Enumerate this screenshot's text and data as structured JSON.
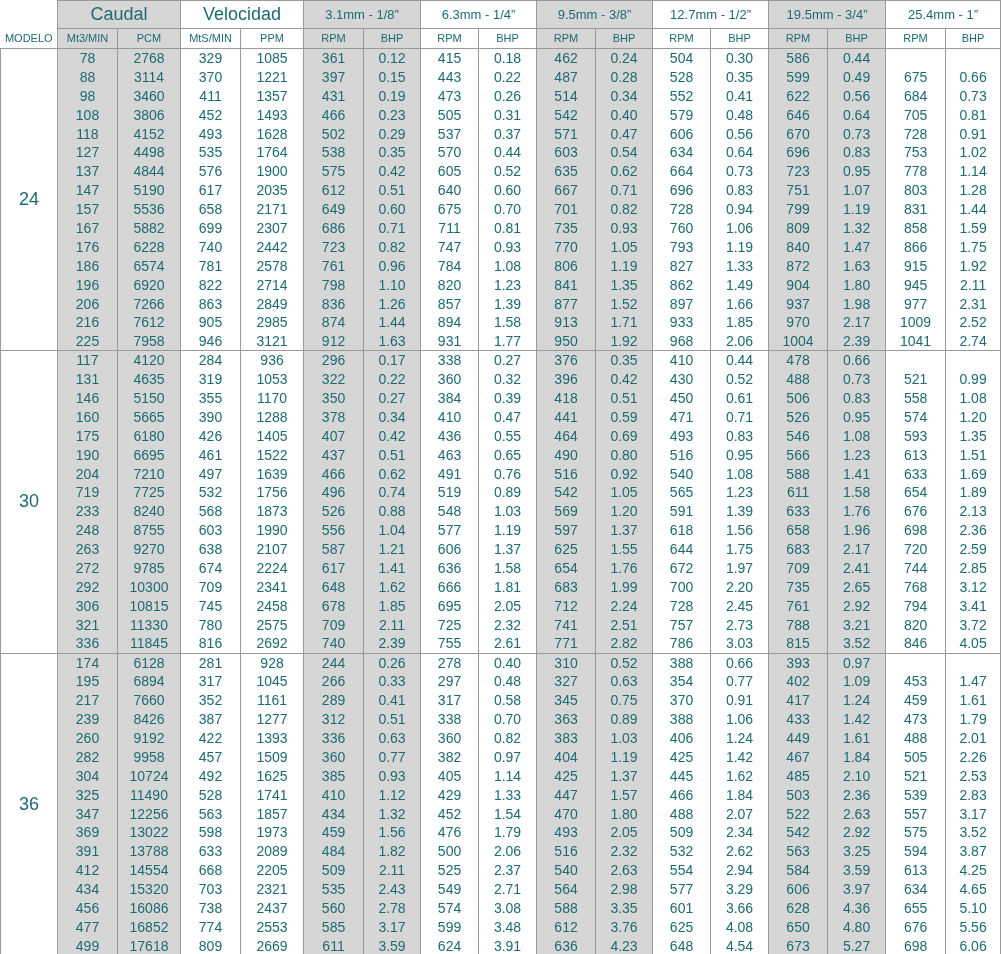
{
  "table": {
    "model_label": "MODELO",
    "groups": [
      {
        "label": "Caudal",
        "columns": [
          "Mt3/MIN",
          "PCM"
        ]
      },
      {
        "label": "Velocidad",
        "columns": [
          "MtS/MIN",
          "PPM"
        ]
      },
      {
        "label": "3.1mm - 1/8”",
        "columns": [
          "RPM",
          "BHP"
        ]
      },
      {
        "label": "6.3mm - 1/4”",
        "columns": [
          "RPM",
          "BHP"
        ]
      },
      {
        "label": "9.5mm - 3/8”",
        "columns": [
          "RPM",
          "BHP"
        ]
      },
      {
        "label": "12.7mm - 1/2”",
        "columns": [
          "RPM",
          "BHP"
        ]
      },
      {
        "label": "19.5mm - 3/4”",
        "columns": [
          "RPM",
          "BHP"
        ]
      },
      {
        "label": "25.4mm - 1”",
        "columns": [
          "RPM",
          "BHP"
        ]
      }
    ],
    "models": [
      {
        "model": "24",
        "rows": [
          [
            "78",
            "2768",
            "329",
            "1085",
            "361",
            "0.12",
            "415",
            "0.18",
            "462",
            "0.24",
            "504",
            "0.30",
            "586",
            "0.44",
            null,
            null
          ],
          [
            "88",
            "3114",
            "370",
            "1221",
            "397",
            "0.15",
            "443",
            "0.22",
            "487",
            "0.28",
            "528",
            "0.35",
            "599",
            "0.49",
            "675",
            "0.66"
          ],
          [
            "98",
            "3460",
            "411",
            "1357",
            "431",
            "0.19",
            "473",
            "0.26",
            "514",
            "0.34",
            "552",
            "0.41",
            "622",
            "0.56",
            "684",
            "0.73"
          ],
          [
            "108",
            "3806",
            "452",
            "1493",
            "466",
            "0.23",
            "505",
            "0.31",
            "542",
            "0.40",
            "579",
            "0.48",
            "646",
            "0.64",
            "705",
            "0.81"
          ],
          [
            "118",
            "4152",
            "493",
            "1628",
            "502",
            "0.29",
            "537",
            "0.37",
            "571",
            "0.47",
            "606",
            "0.56",
            "670",
            "0.73",
            "728",
            "0.91"
          ],
          [
            "127",
            "4498",
            "535",
            "1764",
            "538",
            "0.35",
            "570",
            "0.44",
            "603",
            "0.54",
            "634",
            "0.64",
            "696",
            "0.83",
            "753",
            "1.02"
          ],
          [
            "137",
            "4844",
            "576",
            "1900",
            "575",
            "0.42",
            "605",
            "0.52",
            "635",
            "0.62",
            "664",
            "0.73",
            "723",
            "0.95",
            "778",
            "1.14"
          ],
          [
            "147",
            "5190",
            "617",
            "2035",
            "612",
            "0.51",
            "640",
            "0.60",
            "667",
            "0.71",
            "696",
            "0.83",
            "751",
            "1.07",
            "803",
            "1.28"
          ],
          [
            "157",
            "5536",
            "658",
            "2171",
            "649",
            "0.60",
            "675",
            "0.70",
            "701",
            "0.82",
            "728",
            "0.94",
            "799",
            "1.19",
            "831",
            "1.44"
          ],
          [
            "167",
            "5882",
            "699",
            "2307",
            "686",
            "0.71",
            "711",
            "0.81",
            "735",
            "0.93",
            "760",
            "1.06",
            "809",
            "1.32",
            "858",
            "1.59"
          ],
          [
            "176",
            "6228",
            "740",
            "2442",
            "723",
            "0.82",
            "747",
            "0.93",
            "770",
            "1.05",
            "793",
            "1.19",
            "840",
            "1.47",
            "866",
            "1.75"
          ],
          [
            "186",
            "6574",
            "781",
            "2578",
            "761",
            "0.96",
            "784",
            "1.08",
            "806",
            "1.19",
            "827",
            "1.33",
            "872",
            "1.63",
            "915",
            "1.92"
          ],
          [
            "196",
            "6920",
            "822",
            "2714",
            "798",
            "1.10",
            "820",
            "1.23",
            "841",
            "1.35",
            "862",
            "1.49",
            "904",
            "1.80",
            "945",
            "2.11"
          ],
          [
            "206",
            "7266",
            "863",
            "2849",
            "836",
            "1.26",
            "857",
            "1.39",
            "877",
            "1.52",
            "897",
            "1.66",
            "937",
            "1.98",
            "977",
            "2.31"
          ],
          [
            "216",
            "7612",
            "905",
            "2985",
            "874",
            "1.44",
            "894",
            "1.58",
            "913",
            "1.71",
            "933",
            "1.85",
            "970",
            "2.17",
            "1009",
            "2.52"
          ],
          [
            "225",
            "7958",
            "946",
            "3121",
            "912",
            "1.63",
            "931",
            "1.77",
            "950",
            "1.92",
            "968",
            "2.06",
            "1004",
            "2.39",
            "1041",
            "2.74"
          ]
        ]
      },
      {
        "model": "30",
        "rows": [
          [
            "117",
            "4120",
            "284",
            "936",
            "296",
            "0.17",
            "338",
            "0.27",
            "376",
            "0.35",
            "410",
            "0.44",
            "478",
            "0.66",
            null,
            null
          ],
          [
            "131",
            "4635",
            "319",
            "1053",
            "322",
            "0.22",
            "360",
            "0.32",
            "396",
            "0.42",
            "430",
            "0.52",
            "488",
            "0.73",
            "521",
            "0.99"
          ],
          [
            "146",
            "5150",
            "355",
            "1170",
            "350",
            "0.27",
            "384",
            "0.39",
            "418",
            "0.51",
            "450",
            "0.61",
            "506",
            "0.83",
            "558",
            "1.08"
          ],
          [
            "160",
            "5665",
            "390",
            "1288",
            "378",
            "0.34",
            "410",
            "0.47",
            "441",
            "0.59",
            "471",
            "0.71",
            "526",
            "0.95",
            "574",
            "1.20"
          ],
          [
            "175",
            "6180",
            "426",
            "1405",
            "407",
            "0.42",
            "436",
            "0.55",
            "464",
            "0.69",
            "493",
            "0.83",
            "546",
            "1.08",
            "593",
            "1.35"
          ],
          [
            "190",
            "6695",
            "461",
            "1522",
            "437",
            "0.51",
            "463",
            "0.65",
            "490",
            "0.80",
            "516",
            "0.95",
            "566",
            "1.23",
            "613",
            "1.51"
          ],
          [
            "204",
            "7210",
            "497",
            "1639",
            "466",
            "0.62",
            "491",
            "0.76",
            "516",
            "0.92",
            "540",
            "1.08",
            "588",
            "1.41",
            "633",
            "1.69"
          ],
          [
            "719",
            "7725",
            "532",
            "1756",
            "496",
            "0.74",
            "519",
            "0.89",
            "542",
            "1.05",
            "565",
            "1.23",
            "611",
            "1.58",
            "654",
            "1.89"
          ],
          [
            "233",
            "8240",
            "568",
            "1873",
            "526",
            "0.88",
            "548",
            "1.03",
            "569",
            "1.20",
            "591",
            "1.39",
            "633",
            "1.76",
            "676",
            "2.13"
          ],
          [
            "248",
            "8755",
            "603",
            "1990",
            "556",
            "1.04",
            "577",
            "1.19",
            "597",
            "1.37",
            "618",
            "1.56",
            "658",
            "1.96",
            "698",
            "2.36"
          ],
          [
            "263",
            "9270",
            "638",
            "2107",
            "587",
            "1.21",
            "606",
            "1.37",
            "625",
            "1.55",
            "644",
            "1.75",
            "683",
            "2.17",
            "720",
            "2.59"
          ],
          [
            "272",
            "9785",
            "674",
            "2224",
            "617",
            "1.41",
            "636",
            "1.58",
            "654",
            "1.76",
            "672",
            "1.97",
            "709",
            "2.41",
            "744",
            "2.85"
          ],
          [
            "292",
            "10300",
            "709",
            "2341",
            "648",
            "1.62",
            "666",
            "1.81",
            "683",
            "1.99",
            "700",
            "2.20",
            "735",
            "2.65",
            "768",
            "3.12"
          ],
          [
            "306",
            "10815",
            "745",
            "2458",
            "678",
            "1.85",
            "695",
            "2.05",
            "712",
            "2.24",
            "728",
            "2.45",
            "761",
            "2.92",
            "794",
            "3.41"
          ],
          [
            "321",
            "11330",
            "780",
            "2575",
            "709",
            "2.11",
            "725",
            "2.32",
            "741",
            "2.51",
            "757",
            "2.73",
            "788",
            "3.21",
            "820",
            "3.72"
          ],
          [
            "336",
            "11845",
            "816",
            "2692",
            "740",
            "2.39",
            "755",
            "2.61",
            "771",
            "2.82",
            "786",
            "3.03",
            "815",
            "3.52",
            "846",
            "4.05"
          ]
        ]
      },
      {
        "model": "36",
        "rows": [
          [
            "174",
            "6128",
            "281",
            "928",
            "244",
            "0.26",
            "278",
            "0.40",
            "310",
            "0.52",
            "388",
            "0.66",
            "393",
            "0.97",
            null,
            null
          ],
          [
            "195",
            "6894",
            "317",
            "1045",
            "266",
            "0.33",
            "297",
            "0.48",
            "327",
            "0.63",
            "354",
            "0.77",
            "402",
            "1.09",
            "453",
            "1.47"
          ],
          [
            "217",
            "7660",
            "352",
            "1161",
            "289",
            "0.41",
            "317",
            "0.58",
            "345",
            "0.75",
            "370",
            "0.91",
            "417",
            "1.24",
            "459",
            "1.61"
          ],
          [
            "239",
            "8426",
            "387",
            "1277",
            "312",
            "0.51",
            "338",
            "0.70",
            "363",
            "0.89",
            "388",
            "1.06",
            "433",
            "1.42",
            "473",
            "1.79"
          ],
          [
            "260",
            "9192",
            "422",
            "1393",
            "336",
            "0.63",
            "360",
            "0.82",
            "383",
            "1.03",
            "406",
            "1.24",
            "449",
            "1.61",
            "488",
            "2.01"
          ],
          [
            "282",
            "9958",
            "457",
            "1509",
            "360",
            "0.77",
            "382",
            "0.97",
            "404",
            "1.19",
            "425",
            "1.42",
            "467",
            "1.84",
            "505",
            "2.26"
          ],
          [
            "304",
            "10724",
            "492",
            "1625",
            "385",
            "0.93",
            "405",
            "1.14",
            "425",
            "1.37",
            "445",
            "1.62",
            "485",
            "2.10",
            "521",
            "2.53"
          ],
          [
            "325",
            "11490",
            "528",
            "1741",
            "410",
            "1.12",
            "429",
            "1.33",
            "447",
            "1.57",
            "466",
            "1.84",
            "503",
            "2.36",
            "539",
            "2.83"
          ],
          [
            "347",
            "12256",
            "563",
            "1857",
            "434",
            "1.32",
            "452",
            "1.54",
            "470",
            "1.80",
            "488",
            "2.07",
            "522",
            "2.63",
            "557",
            "3.17"
          ],
          [
            "369",
            "13022",
            "598",
            "1973",
            "459",
            "1.56",
            "476",
            "1.79",
            "493",
            "2.05",
            "509",
            "2.34",
            "542",
            "2.92",
            "575",
            "3.52"
          ],
          [
            "391",
            "13788",
            "633",
            "2089",
            "484",
            "1.82",
            "500",
            "2.06",
            "516",
            "2.32",
            "532",
            "2.62",
            "563",
            "3.25",
            "594",
            "3.87"
          ],
          [
            "412",
            "14554",
            "668",
            "2205",
            "509",
            "2.11",
            "525",
            "2.37",
            "540",
            "2.63",
            "554",
            "2.94",
            "584",
            "3.59",
            "613",
            "4.25"
          ],
          [
            "434",
            "15320",
            "703",
            "2321",
            "535",
            "2.43",
            "549",
            "2.71",
            "564",
            "2.98",
            "577",
            "3.29",
            "606",
            "3.97",
            "634",
            "4.65"
          ],
          [
            "456",
            "16086",
            "738",
            "2437",
            "560",
            "2.78",
            "574",
            "3.08",
            "588",
            "3.35",
            "601",
            "3.66",
            "628",
            "4.36",
            "655",
            "5.10"
          ],
          [
            "477",
            "16852",
            "774",
            "2553",
            "585",
            "3.17",
            "599",
            "3.48",
            "612",
            "3.76",
            "625",
            "4.08",
            "650",
            "4.80",
            "676",
            "5.56"
          ],
          [
            "499",
            "17618",
            "809",
            "2669",
            "611",
            "3.59",
            "624",
            "3.91",
            "636",
            "4.23",
            "648",
            "4.54",
            "673",
            "5.27",
            "698",
            "6.06"
          ]
        ]
      }
    ]
  }
}
